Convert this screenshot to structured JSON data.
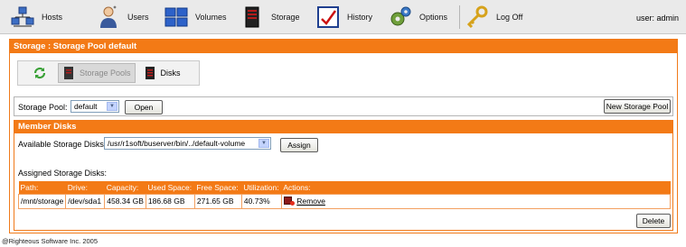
{
  "nav": {
    "items": [
      {
        "label": "Hosts",
        "icon": "hosts-icon"
      },
      {
        "label": "Users",
        "icon": "users-icon"
      },
      {
        "label": "Volumes",
        "icon": "volumes-icon"
      },
      {
        "label": "Storage",
        "icon": "storage-icon"
      },
      {
        "label": "History",
        "icon": "history-icon"
      },
      {
        "label": "Options",
        "icon": "options-icon"
      },
      {
        "label": "Log Off",
        "icon": "key-icon"
      }
    ],
    "user": "user: admin"
  },
  "panel": {
    "title": "Storage : Storage Pool default",
    "tabs": [
      {
        "label": "",
        "icon": "refresh-icon"
      },
      {
        "label": "Storage Pools",
        "icon": "storage-pool-icon",
        "active": true
      },
      {
        "label": "Disks",
        "icon": "disk-icon"
      }
    ]
  },
  "pool": {
    "label": "Storage Pool:",
    "selected": "default",
    "open_label": "Open",
    "new_label": "New Storage Pool"
  },
  "member": {
    "title": "Member Disks",
    "available_label": "Available Storage Disks",
    "available_selected": "/usr/r1soft/buserver/bin/../default-volume",
    "assign_label": "Assign",
    "assigned_label": "Assigned Storage Disks:",
    "columns": [
      "Path:",
      "Drive:",
      "Capacity:",
      "Used Space:",
      "Free Space:",
      "Utilization:",
      "Actions:"
    ],
    "rows": [
      [
        "/mnt/storage",
        "/dev/sda1",
        "458.34 GB",
        "186.68 GB",
        "271.65 GB",
        "40.73%",
        "Remove"
      ]
    ],
    "delete_label": "Delete"
  },
  "footer": "@Righteous Software Inc. 2005",
  "colors": {
    "accent": "#f37a16",
    "nav_bg": "#eaeaea"
  }
}
